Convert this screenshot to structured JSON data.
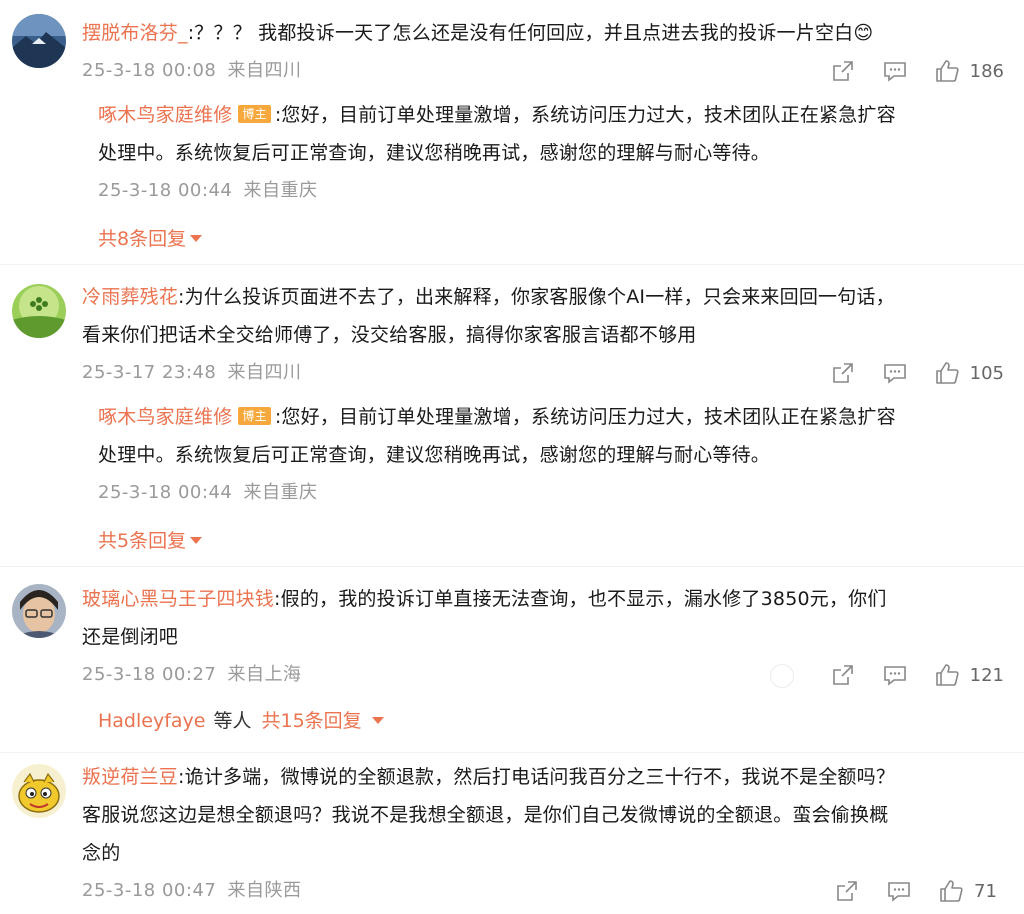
{
  "comments": [
    {
      "user": "摆脱布洛芬_",
      "text": ":？？？ 我都投诉一天了怎么还是没有任何回应，并且点进去我的投诉一片空白",
      "emoji": "😊",
      "time": "25-3-18 00:08",
      "loc": "来自四川",
      "likes": "186",
      "reply": {
        "user": "啄木鸟家庭维修",
        "badge": "博主",
        "text_line1": ":您好，目前订单处理量激增，系统访问压力过大，技术团队正在紧急扩容",
        "text_line2": "处理中。系统恢复后可正常查询，建议您稍晚再试，感谢您的理解与耐心等待。",
        "time": "25-3-18 00:44",
        "loc": "来自重庆"
      },
      "more": "共8条回复"
    },
    {
      "user": "冷雨葬残花",
      "text_line1": ":为什么投诉页面进不去了，出来解释，你家客服像个AI一样，只会来来回回一句话，",
      "text_line2": "看来你们把话术全交给师傅了，没交给客服，搞得你家客服言语都不够用",
      "time": "25-3-17 23:48",
      "loc": "来自四川",
      "likes": "105",
      "reply": {
        "user": "啄木鸟家庭维修",
        "badge": "博主",
        "text_line1": ":您好，目前订单处理量激增，系统访问压力过大，技术团队正在紧急扩容",
        "text_line2": "处理中。系统恢复后可正常查询，建议您稍晚再试，感谢您的理解与耐心等待。",
        "time": "25-3-18 00:44",
        "loc": "来自重庆"
      },
      "more": "共5条回复"
    },
    {
      "user": "玻璃心黑马王子四块钱",
      "text_line1": ":假的，我的投诉订单直接无法查询，也不显示，漏水修了3850元，你们",
      "text_line2": "还是倒闭吧",
      "time": "25-3-18 00:27",
      "loc": "来自上海",
      "likes": "121",
      "replier": "Hadleyfaye",
      "deng": "等人",
      "more": "共15条回复"
    },
    {
      "user": "叛逆荷兰豆",
      "text_line1": ":诡计多端，微博说的全额退款，然后打电话问我百分之三十行不，我说不是全额吗？",
      "text_line2": "客服说您这边是想全额退吗？我说不是我想全额退，是你们自己发微博说的全额退。蛮会偷换概",
      "text_line3": "念的",
      "time": "25-3-18 00:47",
      "loc": "来自陕西",
      "likes": "71"
    }
  ],
  "icons": {
    "share": "share-icon",
    "comment": "comment-icon",
    "like": "like-icon",
    "expand": "caret-down-icon"
  },
  "colors": {
    "username": "#eb7350",
    "meta": "#9a9a9a",
    "badge": "#f7a83c"
  }
}
